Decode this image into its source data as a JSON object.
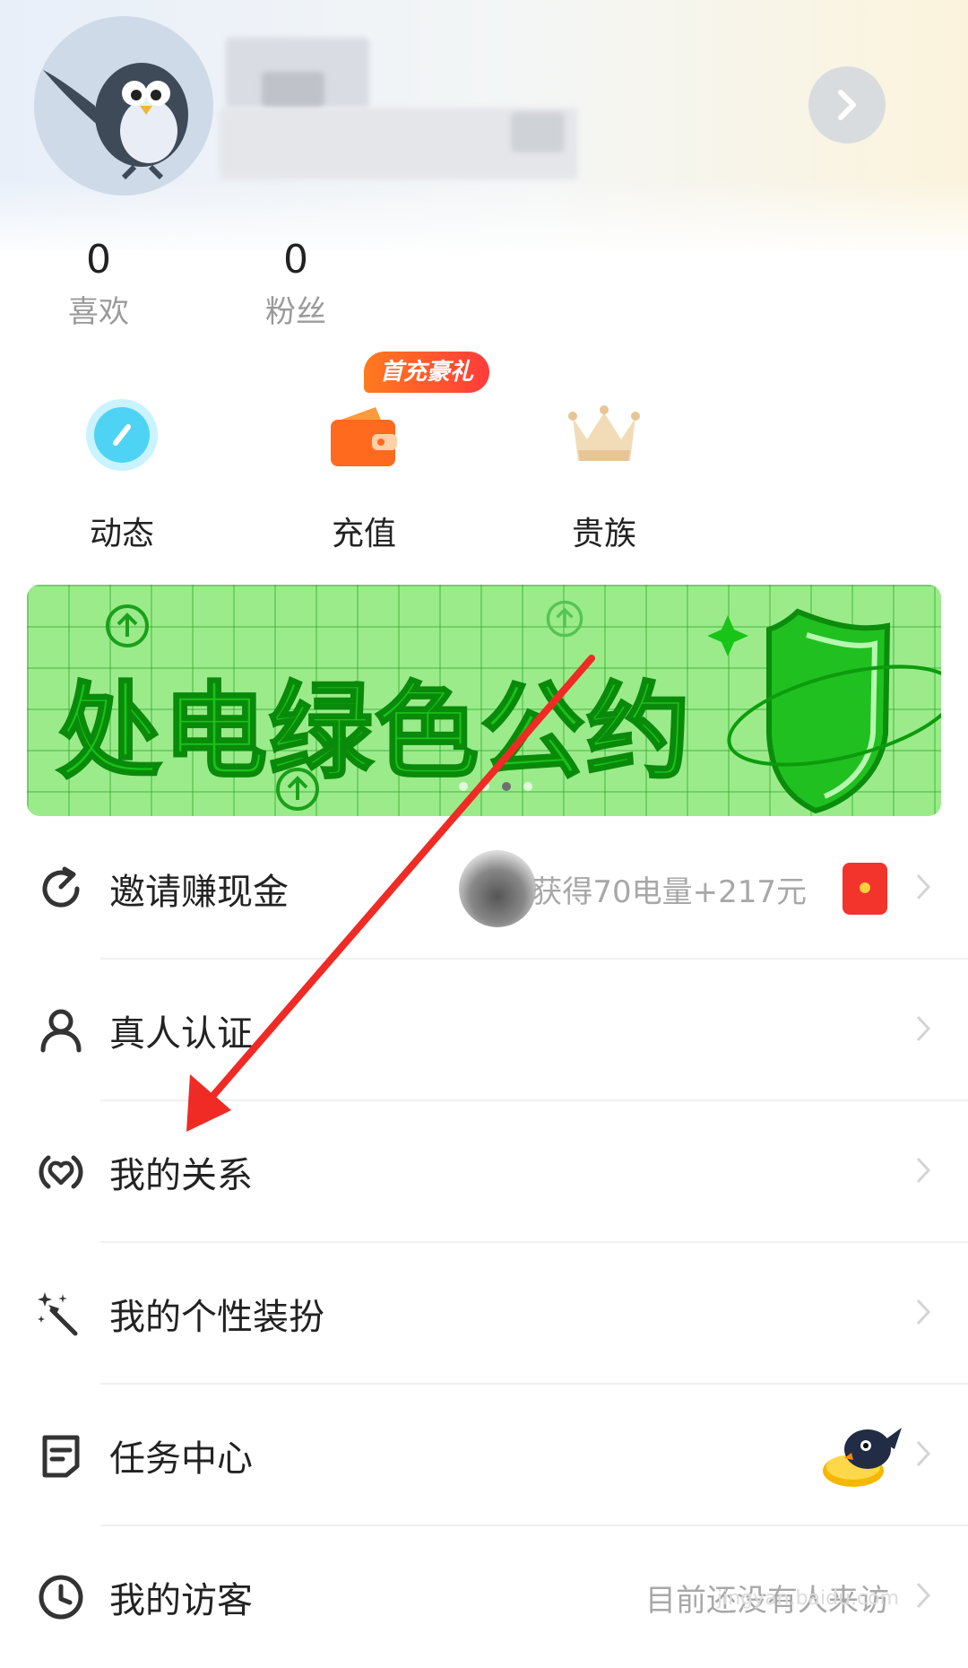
{
  "profile": {
    "stats": [
      {
        "value": "0",
        "label": "喜欢"
      },
      {
        "value": "0",
        "label": "粉丝"
      }
    ]
  },
  "quick_actions": [
    {
      "label": "动态",
      "icon": "clock-bubble-icon"
    },
    {
      "label": "充值",
      "icon": "wallet-icon",
      "badge": "首充豪礼"
    },
    {
      "label": "贵族",
      "icon": "crown-icon"
    }
  ],
  "banner": {
    "text": "处电绿色公约",
    "page_count": 4,
    "active_page": 3
  },
  "menu": [
    {
      "label": "邀请赚现金",
      "icon": "refresh-icon",
      "right_text": "获得70电量+217元"
    },
    {
      "label": "真人认证",
      "icon": "person-icon"
    },
    {
      "label": "我的关系",
      "icon": "heart-link-icon"
    },
    {
      "label": "我的个性装扮",
      "icon": "magic-wand-icon"
    },
    {
      "label": "任务中心",
      "icon": "task-doc-icon"
    },
    {
      "label": "我的访客",
      "icon": "clock-icon",
      "right_text": "目前还没有人来访"
    }
  ],
  "watermark": "jingyan.baidu.com",
  "colors": {
    "accent_orange": "#ff6a1e",
    "banner_green": "#18c418",
    "annotation_arrow": "#f02a24"
  }
}
